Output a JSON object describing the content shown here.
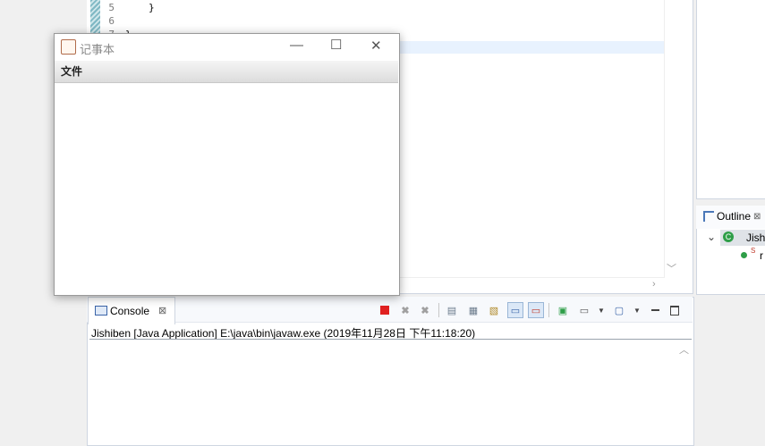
{
  "editor": {
    "lines": [
      {
        "num": "5",
        "code": "}"
      },
      {
        "num": "6",
        "code": ""
      },
      {
        "num": "7",
        "code": "}"
      }
    ]
  },
  "notepad": {
    "title": "记事本",
    "menu_file": "文件",
    "minimize_glyph": "—",
    "maximize_glyph": "☐",
    "close_glyph": "✕"
  },
  "console": {
    "tab_label": "Console",
    "tab_close": "⊠",
    "output_line": "Jishiben [Java Application] E:\\java\\bin\\javaw.exe (2019年11月28日 下午11:18:20)"
  },
  "outline": {
    "tab_label": "Outline",
    "tab_close": "⊠",
    "item1_label": "Jish",
    "item2_badge": "S",
    "item2_label": "r"
  },
  "colors": {
    "terminate_red": "#e02020",
    "highlight_line": "#e8f2fe",
    "accent_green": "#2e9e48"
  }
}
